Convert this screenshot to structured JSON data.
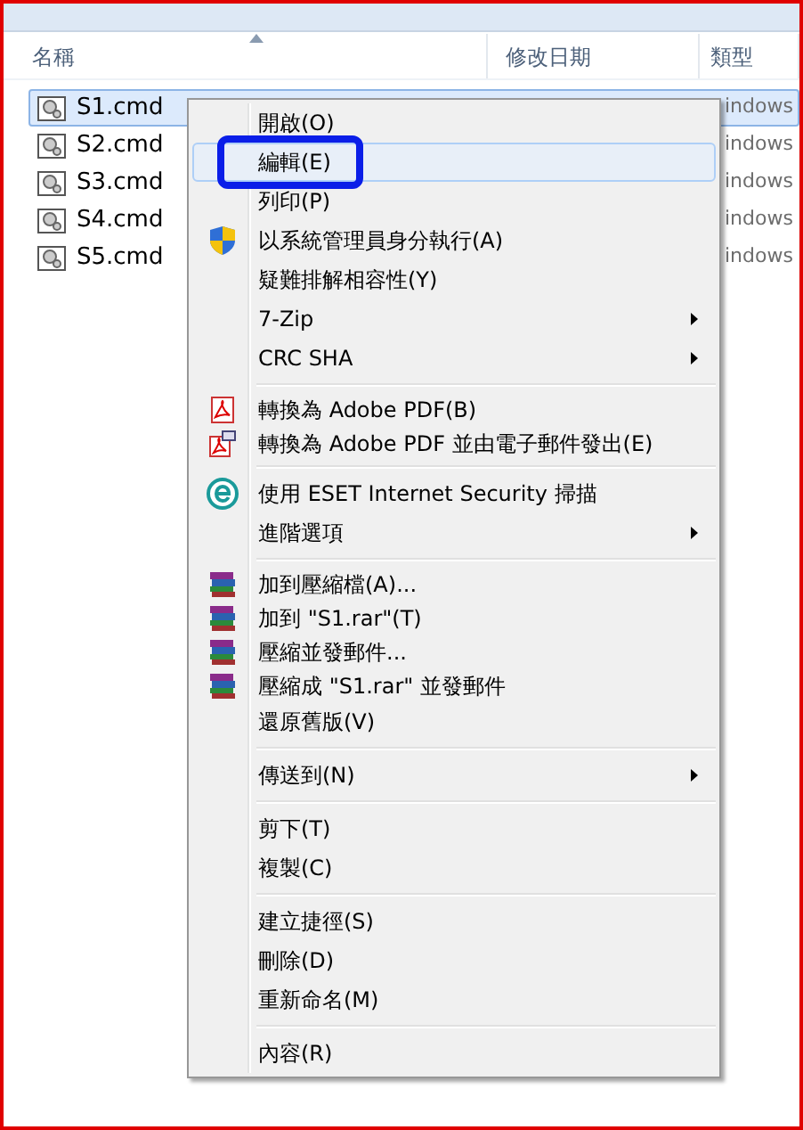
{
  "columns": [
    {
      "label": "名稱",
      "sorted": true
    },
    {
      "label": "修改日期",
      "sorted": false
    },
    {
      "label": "類型",
      "sorted": false
    }
  ],
  "files": [
    {
      "name": "S1.cmd",
      "type": "indows",
      "selected": true
    },
    {
      "name": "S2.cmd",
      "type": "indows",
      "selected": false
    },
    {
      "name": "S3.cmd",
      "type": "indows",
      "selected": false
    },
    {
      "name": "S4.cmd",
      "type": "indows",
      "selected": false
    },
    {
      "name": "S5.cmd",
      "type": "indows",
      "selected": false
    }
  ],
  "menu": [
    {
      "kind": "item",
      "label": "開啟(O)",
      "selected": false
    },
    {
      "kind": "item",
      "label": "編輯(E)",
      "selected": true
    },
    {
      "kind": "item",
      "label": "列印(P)",
      "selected": false
    },
    {
      "kind": "admin",
      "label": "以系統管理員身分執行(A)",
      "selected": false
    },
    {
      "kind": "item",
      "label": "疑難排解相容性(Y)",
      "selected": false
    },
    {
      "kind": "item",
      "label": "7-Zip",
      "submenu": true,
      "selected": false
    },
    {
      "kind": "item",
      "label": "CRC SHA",
      "submenu": true,
      "selected": false
    },
    {
      "kind": "separator"
    },
    {
      "kind": "pdf",
      "label": "轉換為 Adobe PDF(B)",
      "selected": false
    },
    {
      "kind": "pdfmail",
      "label": "轉換為 Adobe PDF 並由電子郵件發出(E)",
      "selected": false
    },
    {
      "kind": "separator"
    },
    {
      "kind": "scan",
      "label": "使用 ESET Internet Security 掃描",
      "selected": false
    },
    {
      "kind": "item",
      "label": "進階選項",
      "submenu": true,
      "selected": false
    },
    {
      "kind": "separator"
    },
    {
      "kind": "archive",
      "label": "加到壓縮檔(A)...",
      "selected": false
    },
    {
      "kind": "archive",
      "label": "加到 \"S1.rar\"(T)",
      "selected": false
    },
    {
      "kind": "archive",
      "label": "壓縮並發郵件...",
      "selected": false
    },
    {
      "kind": "archive",
      "label": "壓縮成 \"S1.rar\" 並發郵件",
      "selected": false
    },
    {
      "kind": "item",
      "label": "還原舊版(V)",
      "selected": false
    },
    {
      "kind": "separator"
    },
    {
      "kind": "item",
      "label": "傳送到(N)",
      "submenu": true,
      "selected": false
    },
    {
      "kind": "separator"
    },
    {
      "kind": "item",
      "label": "剪下(T)",
      "selected": false
    },
    {
      "kind": "item",
      "label": "複製(C)",
      "selected": false
    },
    {
      "kind": "separator"
    },
    {
      "kind": "item",
      "label": "建立捷徑(S)",
      "selected": false
    },
    {
      "kind": "item",
      "label": "刪除(D)",
      "selected": false
    },
    {
      "kind": "item",
      "label": "重新命名(M)",
      "selected": false
    },
    {
      "kind": "separator"
    },
    {
      "kind": "item",
      "label": "內容(R)",
      "selected": false
    }
  ]
}
